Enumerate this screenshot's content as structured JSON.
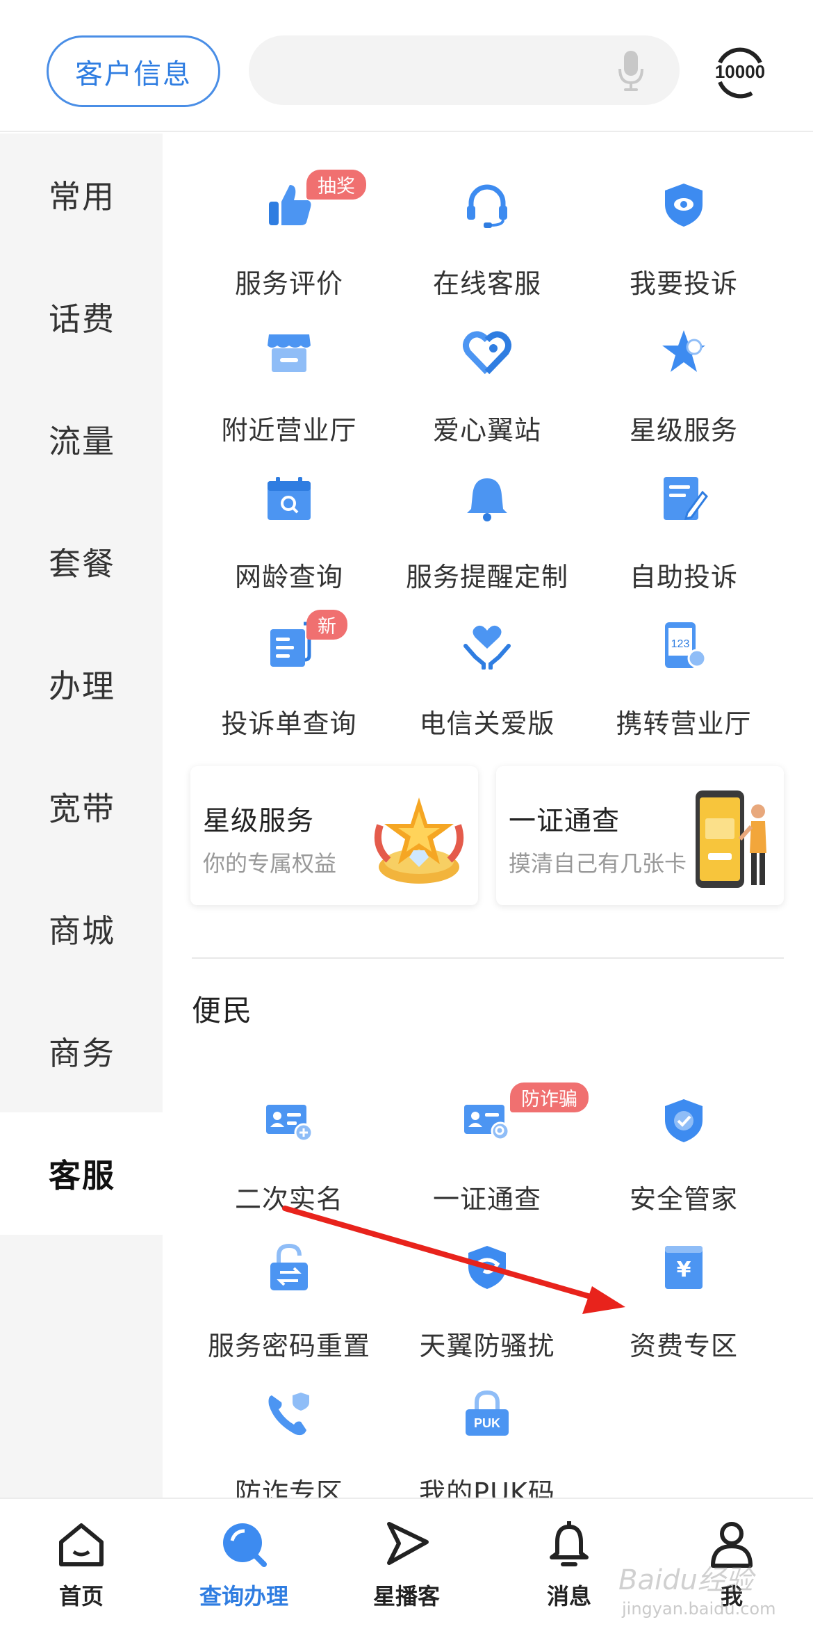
{
  "header": {
    "customer_info_label": "客户信息",
    "search_placeholder": "",
    "hotline_label": "10000"
  },
  "sidebar": {
    "items": [
      {
        "label": "常用"
      },
      {
        "label": "话费"
      },
      {
        "label": "流量"
      },
      {
        "label": "套餐"
      },
      {
        "label": "办理"
      },
      {
        "label": "宽带"
      },
      {
        "label": "商城"
      },
      {
        "label": "商务"
      },
      {
        "label": "客服",
        "active": true
      }
    ]
  },
  "service_grid": [
    {
      "label": "服务评价",
      "icon": "thumbs-up-icon",
      "badge": "抽奖"
    },
    {
      "label": "在线客服",
      "icon": "headset-icon"
    },
    {
      "label": "我要投诉",
      "icon": "shield-eye-icon"
    },
    {
      "label": "附近营业厅",
      "icon": "store-icon"
    },
    {
      "label": "爱心翼站",
      "icon": "heart-location-icon"
    },
    {
      "label": "星级服务",
      "icon": "star-icon"
    },
    {
      "label": "网龄查询",
      "icon": "calendar-search-icon"
    },
    {
      "label": "服务提醒定制",
      "icon": "bell-icon"
    },
    {
      "label": "自助投诉",
      "icon": "edit-document-icon"
    },
    {
      "label": "投诉单查询",
      "icon": "complaint-list-icon",
      "badge": "新"
    },
    {
      "label": "电信关爱版",
      "icon": "heart-hands-icon"
    },
    {
      "label": "携转营业厅",
      "icon": "number-transfer-icon"
    }
  ],
  "promo_cards": [
    {
      "title": "星级服务",
      "subtitle": "你的专属权益",
      "image": "star-crown-illustration"
    },
    {
      "title": "一证通查",
      "subtitle": "摸清自己有几张卡",
      "image": "phone-person-illustration"
    }
  ],
  "convenience": {
    "title": "便民",
    "items": [
      {
        "label": "二次实名",
        "icon": "id-card-add-icon"
      },
      {
        "label": "一证通查",
        "icon": "id-card-search-icon",
        "badge": "防诈骗"
      },
      {
        "label": "安全管家",
        "icon": "shield-check-icon"
      },
      {
        "label": "服务密码重置",
        "icon": "lock-swap-icon"
      },
      {
        "label": "天翼防骚扰",
        "icon": "shield-swirl-icon"
      },
      {
        "label": "资费专区",
        "icon": "yuan-book-icon"
      },
      {
        "label": "防诈专区",
        "icon": "phone-shield-icon"
      },
      {
        "label": "我的PUK码",
        "icon": "puk-lock-icon"
      }
    ]
  },
  "tabbar": {
    "items": [
      {
        "label": "首页",
        "icon": "home-icon"
      },
      {
        "label": "查询办理",
        "icon": "search-tab-icon",
        "active": true
      },
      {
        "label": "星播客",
        "icon": "play-icon"
      },
      {
        "label": "消息",
        "icon": "bell-tab-icon"
      },
      {
        "label": "我",
        "icon": "user-icon"
      }
    ]
  },
  "colors": {
    "accent": "#2f7de1",
    "icon_blue": "#3d8bf0",
    "badge_red": "#f07070",
    "annotation_arrow": "#e8231c"
  },
  "watermark": {
    "brand": "Baidu经验",
    "url": "jingyan.baidu.com"
  }
}
